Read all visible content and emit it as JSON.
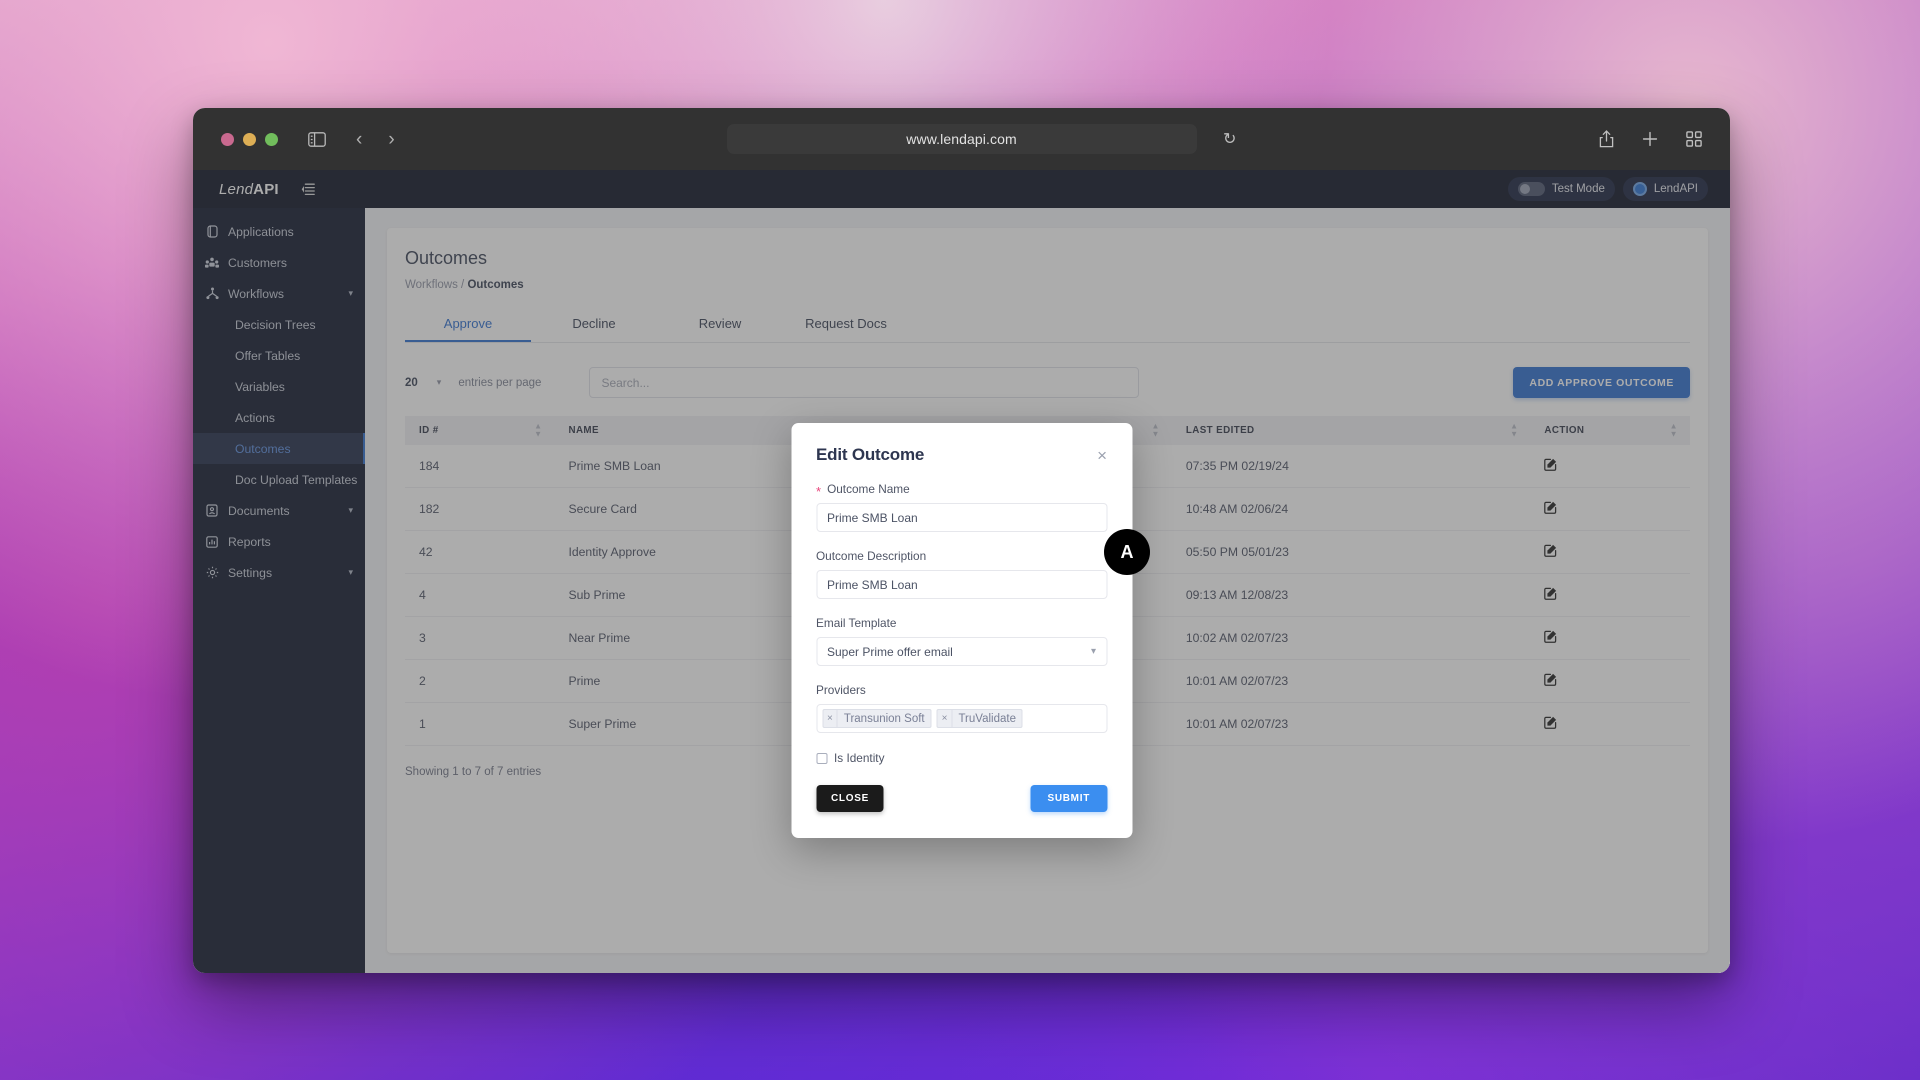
{
  "browser": {
    "url": "www.lendapi.com",
    "traffic_lights": [
      "close-red",
      "minimize-yellow",
      "maximize-green"
    ],
    "icons": {
      "sidebar_toggle": "sidebar-toggle-icon",
      "back": "‹",
      "forward": "›",
      "reload": "↻",
      "share": "share-icon",
      "new_tab": "+",
      "tab_overview": "tab-overview-icon"
    }
  },
  "app": {
    "brand_lend": "Lend",
    "brand_api": "API",
    "test_mode_label": "Test Mode",
    "account_label": "LendAPI"
  },
  "sidebar": {
    "items": [
      {
        "label": "Applications",
        "icon": "applications-icon",
        "type": "item",
        "expandable": false
      },
      {
        "label": "Customers",
        "icon": "customers-icon",
        "type": "item",
        "expandable": false
      },
      {
        "label": "Workflows",
        "icon": "workflows-icon",
        "type": "item",
        "expandable": true
      },
      {
        "label": "Decision Trees",
        "type": "sub",
        "active": false
      },
      {
        "label": "Offer Tables",
        "type": "sub",
        "active": false
      },
      {
        "label": "Variables",
        "type": "sub",
        "active": false
      },
      {
        "label": "Actions",
        "type": "sub",
        "active": false
      },
      {
        "label": "Outcomes",
        "type": "sub",
        "active": true
      },
      {
        "label": "Doc Upload Templates",
        "type": "sub",
        "active": false
      },
      {
        "label": "Documents",
        "icon": "documents-icon",
        "type": "item",
        "expandable": true
      },
      {
        "label": "Reports",
        "icon": "reports-icon",
        "type": "item",
        "expandable": false
      },
      {
        "label": "Settings",
        "icon": "settings-icon",
        "type": "item",
        "expandable": true
      }
    ]
  },
  "page": {
    "title": "Outcomes",
    "breadcrumb_parent": "Workflows",
    "breadcrumb_separator": "/",
    "breadcrumb_current": "Outcomes",
    "tabs": [
      {
        "label": "Approve",
        "active": true
      },
      {
        "label": "Decline",
        "active": false
      },
      {
        "label": "Review",
        "active": false
      },
      {
        "label": "Request Docs",
        "active": false
      }
    ],
    "entries_per_page_value": "20",
    "entries_per_page_label": "entries per page",
    "search_placeholder": "Search...",
    "add_button_label": "ADD APPROVE OUTCOME",
    "footer_text": "Showing 1 to 7 of 7 entries"
  },
  "table": {
    "columns": [
      "ID #",
      "NAME",
      "",
      "LAST EDITED",
      "ACTION"
    ],
    "rows": [
      {
        "id": "184",
        "name": "Prime SMB Loan",
        "last_edited": "07:35 PM 02/19/24",
        "action": "edit-icon"
      },
      {
        "id": "182",
        "name": "Secure Card",
        "last_edited": "10:48 AM 02/06/24",
        "action": "edit-icon"
      },
      {
        "id": "42",
        "name": "Identity Approve",
        "last_edited": "05:50 PM 05/01/23",
        "action": "edit-icon"
      },
      {
        "id": "4",
        "name": "Sub Prime",
        "last_edited": "09:13 AM 12/08/23",
        "action": "edit-icon"
      },
      {
        "id": "3",
        "name": "Near Prime",
        "last_edited": "10:02 AM 02/07/23",
        "action": "edit-icon"
      },
      {
        "id": "2",
        "name": "Prime",
        "last_edited": "10:01 AM 02/07/23",
        "action": "edit-icon"
      },
      {
        "id": "1",
        "name": "Super Prime",
        "last_edited": "10:01 AM 02/07/23",
        "action": "edit-icon"
      }
    ]
  },
  "modal": {
    "title": "Edit Outcome",
    "close_glyph": "×",
    "outcome_name_label": "Outcome Name",
    "outcome_name_required": "*",
    "outcome_name_value": "Prime SMB Loan",
    "outcome_description_label": "Outcome Description",
    "outcome_description_value": "Prime SMB Loan",
    "email_template_label": "Email Template",
    "email_template_value": "Super Prime offer email",
    "providers_label": "Providers",
    "providers": [
      "Transunion Soft",
      "TruValidate"
    ],
    "tag_remove_glyph": "×",
    "is_identity_label": "Is Identity",
    "is_identity_checked": false,
    "close_button_label": "CLOSE",
    "submit_button_label": "SUBMIT"
  },
  "cursor": {
    "badge_letter": "A"
  },
  "colors": {
    "accent_blue": "#2f6fd0",
    "submit_blue": "#3b8ef0",
    "sidebar_dark": "#11182e",
    "topbar_dark": "#0d1326",
    "required_pink": "#e8467c"
  }
}
